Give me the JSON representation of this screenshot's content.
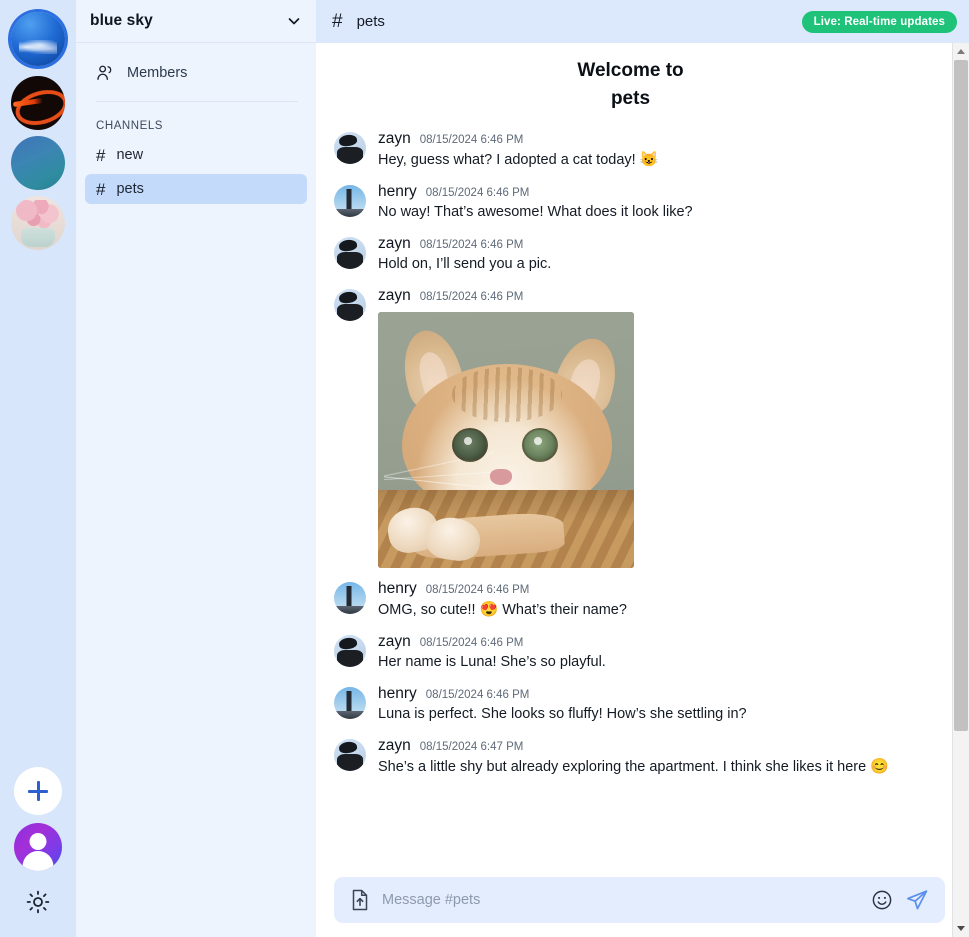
{
  "server_rail": {
    "servers": [
      {
        "name": "blue-sky-server",
        "label": "blue sky",
        "selected": true
      },
      {
        "name": "orange-abstract-server",
        "label": "orange abstract",
        "selected": false
      },
      {
        "name": "teal-gradient-server",
        "label": "teal gradient",
        "selected": false
      },
      {
        "name": "flowers-server",
        "label": "flowers",
        "selected": false
      }
    ],
    "add_server_icon": "plus-icon",
    "user_avatar_icon": "user-avatar-icon",
    "theme_toggle_icon": "sun-icon"
  },
  "sidebar": {
    "server_name": "blue sky",
    "dropdown_icon": "chevron-down-icon",
    "members_label": "Members",
    "members_icon": "people-icon",
    "channels_header": "CHANNELS",
    "channels": [
      {
        "hash": "#",
        "name": "new",
        "active": false
      },
      {
        "hash": "#",
        "name": "pets",
        "active": true
      }
    ]
  },
  "chat_header": {
    "hash": "#",
    "channel": "pets",
    "live_badge": "Live: Real-time updates",
    "live_color": "#1fc279"
  },
  "welcome": {
    "line1": "Welcome to",
    "line2": "pets"
  },
  "messages": [
    {
      "author": "zayn",
      "avatar": "zayn",
      "time": "08/15/2024 6:46 PM",
      "text": "Hey, guess what? I adopted a cat today!",
      "emoji": "😺",
      "has_image": false
    },
    {
      "author": "henry",
      "avatar": "henry",
      "time": "08/15/2024 6:46 PM",
      "text": "No way! That’s awesome! What does it look like?",
      "emoji": "",
      "has_image": false
    },
    {
      "author": "zayn",
      "avatar": "zayn",
      "time": "08/15/2024 6:46 PM",
      "text": "Hold on, I’ll send you a pic.",
      "emoji": "",
      "has_image": false
    },
    {
      "author": "zayn",
      "avatar": "zayn",
      "time": "08/15/2024 6:46 PM",
      "text": "",
      "emoji": "",
      "has_image": true,
      "image_alt": "orange and cream tabby cat resting on a wicker basket"
    },
    {
      "author": "henry",
      "avatar": "henry",
      "time": "08/15/2024 6:46 PM",
      "text_before": "OMG, so cute!!",
      "emoji": "😍",
      "text_after": "What’s their name?",
      "has_image": false,
      "split": true
    },
    {
      "author": "zayn",
      "avatar": "zayn",
      "time": "08/15/2024 6:46 PM",
      "text": "Her name is Luna! She’s so playful.",
      "emoji": "",
      "has_image": false
    },
    {
      "author": "henry",
      "avatar": "henry",
      "time": "08/15/2024 6:46 PM",
      "text": "Luna is perfect. She looks so fluffy! How’s she settling in?",
      "emoji": "",
      "has_image": false
    },
    {
      "author": "zayn",
      "avatar": "zayn",
      "time": "08/15/2024 6:47 PM",
      "text": "She’s a little shy but already exploring the apartment. I think she likes it here",
      "emoji": "😊",
      "has_image": false
    }
  ],
  "composer": {
    "upload_icon": "file-upload-icon",
    "placeholder": "Message #pets",
    "value": "",
    "emoji_icon": "emoji-smiley-icon",
    "send_icon": "send-paper-plane-icon"
  },
  "scrollbar": {
    "up_icon": "scroll-up-arrow-icon",
    "down_icon": "scroll-down-arrow-icon",
    "thumb_position": "top"
  }
}
